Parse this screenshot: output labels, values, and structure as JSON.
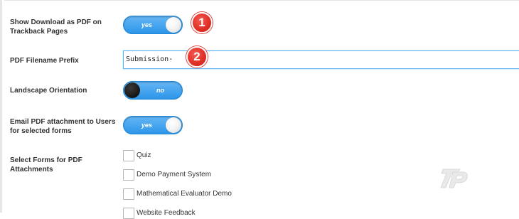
{
  "settings": {
    "show_download_label": "Show Download as PDF on Trackback Pages",
    "show_download_state": "yes",
    "filename_prefix_label": "PDF Filename Prefix",
    "filename_prefix_value": "Submission-",
    "landscape_label": "Landscape Orientation",
    "landscape_state": "no",
    "email_attachment_label": "Email PDF attachment to Users for selected forms",
    "email_attachment_state": "yes",
    "select_forms_label": "Select Forms for PDF Attachments",
    "forms": [
      {
        "label": "Quiz",
        "checked": false
      },
      {
        "label": "Demo Payment System",
        "checked": false
      },
      {
        "label": "Mathematical Evaluator Demo",
        "checked": false
      },
      {
        "label": "Website Feedback",
        "checked": false
      }
    ]
  },
  "annotations": [
    "1",
    "2"
  ],
  "colors": {
    "toggle_on": "#2d96ea",
    "toggle_off": "#2d96ea",
    "badge": "#e02e25",
    "input_focus_border": "#5ab4ee"
  },
  "icons": {
    "watermark": "logo-watermark-icon"
  }
}
